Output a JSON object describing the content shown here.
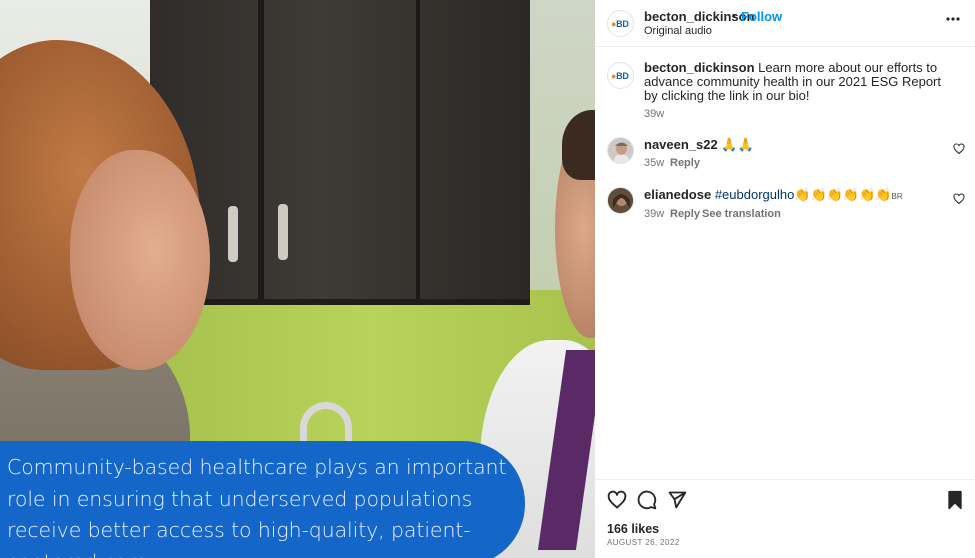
{
  "media": {
    "caption": "Community-based healthcare plays an important role in ensuring that underserved populations receive better access to high-quality, patient-centered care."
  },
  "header": {
    "username": "becton_dickinson",
    "separator": "•",
    "follow_label": "Follow",
    "audio": "Original audio",
    "avatar_text": "BD"
  },
  "post": {
    "username": "becton_dickinson",
    "text": "Learn more about our efforts to advance community health in our 2021 ESG Report by clicking the link in our bio!",
    "time": "39w"
  },
  "comments": [
    {
      "username": "naveen_s22",
      "text": "🙏🙏",
      "time": "35w",
      "reply_label": "Reply"
    },
    {
      "username": "elianedose",
      "hashtag": "#eubdorgulho",
      "text": "👏👏👏👏👏👏",
      "flag": "BR",
      "time": "39w",
      "reply_label": "Reply",
      "translation_label": "See translation"
    }
  ],
  "footer": {
    "likes": "166 likes",
    "date": "AUGUST 26, 2022"
  },
  "icons": {
    "more": "more-horizontal-icon",
    "like": "heart-icon",
    "comment": "comment-icon",
    "share": "send-icon",
    "save": "bookmark-icon"
  },
  "colors": {
    "follow_blue": "#0095f6",
    "caption_box": "#1466c8",
    "hashtag": "#00376b",
    "muted": "#737373"
  }
}
